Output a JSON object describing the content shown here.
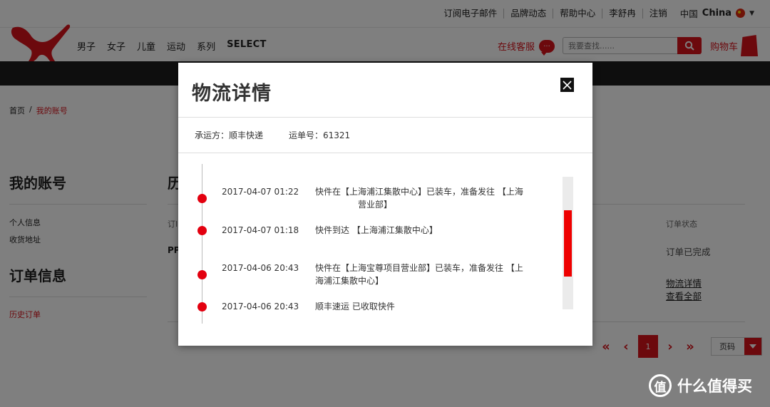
{
  "top_links": [
    "订阅电子邮件",
    "品牌动态",
    "帮助中心",
    "李舒冉",
    "注销"
  ],
  "region": {
    "label": "中国",
    "country": "China"
  },
  "nav": [
    "男子",
    "女子",
    "儿童",
    "运动",
    "系列",
    "SELECT"
  ],
  "service_label": "在线客服",
  "search_placeholder": "我要查找......",
  "cart_label": "购物车",
  "breadcrumb": {
    "home": "首页",
    "separator": "/",
    "current": "我的账号"
  },
  "sidebar": {
    "account_title": "我的账号",
    "account_links": [
      "个人信息",
      "收货地址"
    ],
    "order_title": "订单信息",
    "order_links": [
      "历史订单"
    ]
  },
  "main": {
    "title_partial": "历",
    "col_order_partial": "订I",
    "col_status": "订单状态",
    "row_order_partial": "PP",
    "status_value": "订单已完成",
    "link_logistics": "物流详情",
    "link_view_all": "查看全部"
  },
  "pagination": {
    "first": "«",
    "prev": "‹",
    "current_page": "1",
    "next": "›",
    "last": "»",
    "page_label": "页码"
  },
  "modal": {
    "title": "物流详情",
    "carrier_label": "承运方：顺丰快递",
    "tracking_label": "运单号：61321",
    "events": [
      {
        "time": "2017-04-07 01:22",
        "text": "快件在【上海浦江集散中心】已装车，准备发往 【上海",
        "text2": "营业部】"
      },
      {
        "time": "2017-04-07 01:18",
        "text": "快件到达 【上海浦江集散中心】",
        "text2": ""
      },
      {
        "time": "2017-04-06 20:43",
        "text": "快件在【上海宝尊项目营业部】已装车，准备发往 【上",
        "text2": "海浦江集散中心】"
      },
      {
        "time": "2017-04-06 20:43",
        "text": "顺丰速运 已收取快件",
        "text2": ""
      }
    ],
    "scroll_position": 0.5
  },
  "watermark": {
    "badge": "值",
    "text": "什么值得买"
  },
  "colors": {
    "brand_red": "#d8121b",
    "timeline_red": "#e3000f",
    "dark_band": "#1c1c1c"
  }
}
